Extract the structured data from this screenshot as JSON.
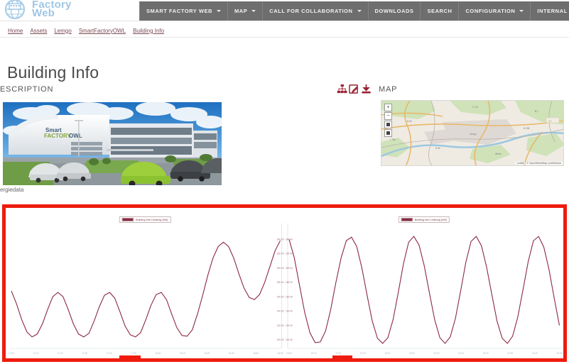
{
  "header": {
    "brand_line1": "Factory",
    "brand_line2": "Web",
    "logo_icon": "globe-factory-logo-icon",
    "nav": [
      {
        "label": "SMART FACTORY WEB",
        "has_caret": true,
        "icon": "chevron-down-icon"
      },
      {
        "label": "MAP",
        "has_caret": true,
        "icon": "chevron-down-icon"
      },
      {
        "label": "CALL FOR COLLABORATION",
        "has_caret": true,
        "icon": "chevron-down-icon"
      },
      {
        "label": "DOWNLOADS",
        "has_caret": false,
        "icon": ""
      },
      {
        "label": "SEARCH",
        "has_caret": false,
        "icon": ""
      },
      {
        "label": "CONFIGURATION",
        "has_caret": true,
        "icon": "chevron-down-icon"
      },
      {
        "label": "INTERNAL",
        "has_caret": true,
        "icon": "chevron-down-icon"
      }
    ]
  },
  "breadcrumb": [
    {
      "label": "Home"
    },
    {
      "label": "Assets"
    },
    {
      "label": "Lemgo"
    },
    {
      "label": "SmartFactoryOWL"
    },
    {
      "label": "Building Info"
    }
  ],
  "page": {
    "title": "Building Info"
  },
  "sections": {
    "description_heading": "ESCRIPTION",
    "map_heading": "MAP",
    "description_caption": "ergiedata"
  },
  "toolbar": {
    "icons": [
      {
        "name": "sitemap-icon",
        "glyph": "sitemap"
      },
      {
        "name": "edit-icon",
        "glyph": "pencil-square"
      },
      {
        "name": "download-icon",
        "glyph": "download"
      }
    ]
  },
  "photo": {
    "alt": "SmartFactoryOWL building exterior",
    "building_label": "SmartFactoryOWL"
  },
  "map": {
    "zoom_in_label": "+",
    "zoom_out_label": "−",
    "layers_label": "layers-icon",
    "attribution": "Leaflet | © OpenStreetMap contributors"
  },
  "colors": {
    "navbar_bg": "#6e6e6e",
    "brand_blue": "#9fc6e4",
    "annotation_red": "#ee1b0e",
    "series_line": "#8b2942",
    "link": "#7d4a55"
  },
  "chart_data": [
    {
      "type": "line",
      "title": "",
      "legend": [
        "Building Info Leistung   (kW)"
      ],
      "legend_position": "top-center",
      "grid": false,
      "xlabel": "",
      "ylabel": "",
      "ylim": [
        90,
        260
      ],
      "y_ticks": [
        100,
        120,
        140,
        160,
        180,
        200,
        220,
        240
      ],
      "x_ticks": [
        "17:00",
        "17:10",
        "17:20",
        "17:30",
        "17:40",
        "17:50",
        "18:00",
        "18:10",
        "18:20",
        "18:30",
        "18:40",
        "18:50"
      ],
      "series": [
        {
          "name": "Building Info Leistung   (kW)",
          "color": "#8b2942",
          "values": [
            168,
            150,
            128,
            111,
            104,
            108,
            122,
            142,
            160,
            166,
            160,
            142,
            122,
            108,
            104,
            109,
            126,
            146,
            162,
            166,
            158,
            139,
            119,
            107,
            104,
            110,
            128,
            148,
            163,
            166,
            156,
            136,
            117,
            106,
            105,
            114,
            136,
            162,
            190,
            214,
            230,
            236,
            230,
            214,
            192,
            172,
            159,
            156,
            163,
            180,
            202,
            224,
            238
          ]
        }
      ]
    },
    {
      "type": "line",
      "title": "",
      "legend": [
        "Building Info Leistung   (kW)"
      ],
      "legend_position": "top-center",
      "grid": false,
      "xlabel": "",
      "ylabel": "",
      "ylim": [
        90,
        260
      ],
      "y_ticks": [
        100,
        120,
        140,
        160,
        180,
        200,
        220,
        240
      ],
      "x_ticks": [
        "19:00",
        "19:10",
        "19:20",
        "19:30",
        "19:40",
        "19:50",
        "20:00",
        "20:10",
        "20:20",
        "20:30",
        "20:40",
        "20:50"
      ],
      "series": [
        {
          "name": "Building Info Leistung   (kW)",
          "color": "#8b2942",
          "values": [
            240,
            214,
            176,
            138,
            110,
            96,
            97,
            112,
            142,
            180,
            214,
            238,
            243,
            230,
            200,
            162,
            126,
            102,
            95,
            103,
            128,
            166,
            206,
            236,
            244,
            232,
            203,
            165,
            128,
            103,
            95,
            104,
            130,
            168,
            208,
            237,
            244,
            231,
            201,
            163,
            126,
            102,
            95,
            105,
            132,
            170,
            209,
            238,
            244,
            229,
            198,
            158,
            120
          ]
        }
      ]
    }
  ]
}
